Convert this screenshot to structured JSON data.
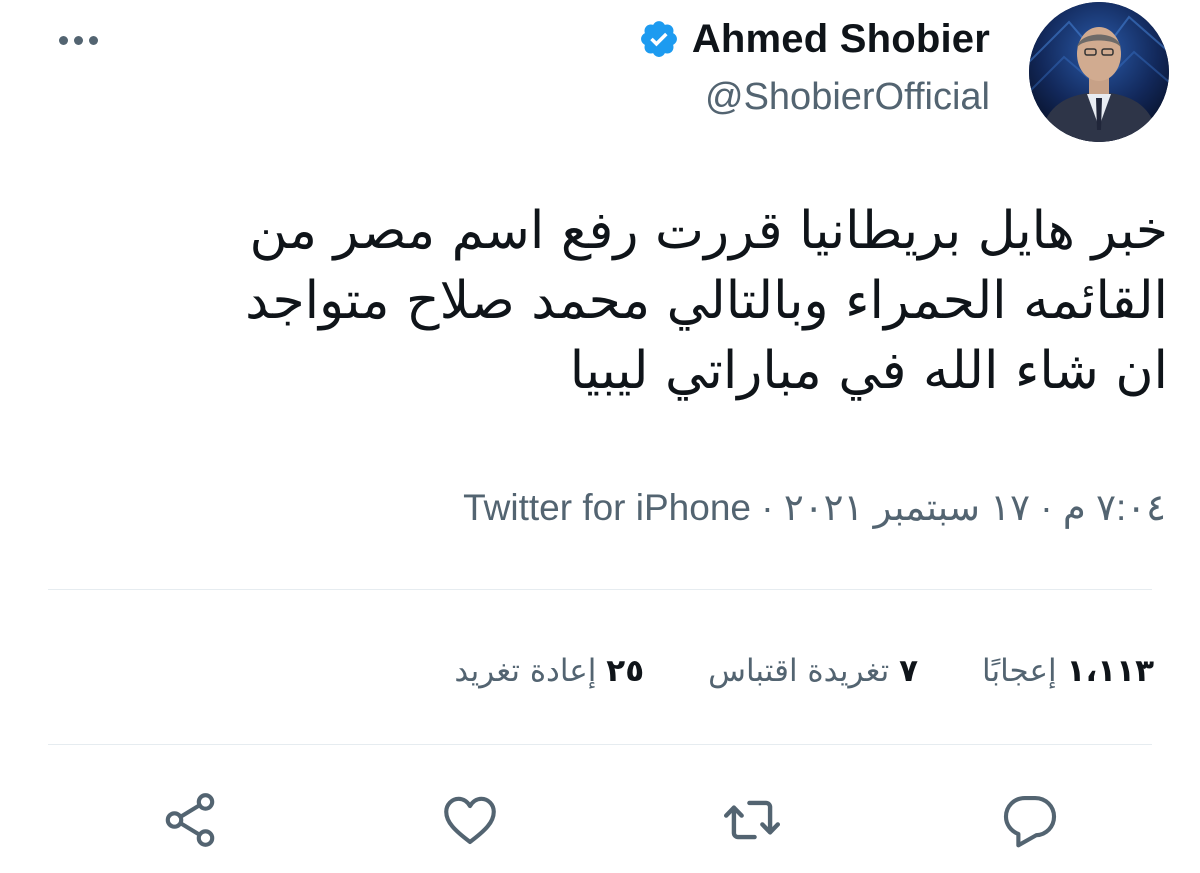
{
  "header": {
    "display_name": "Ahmed Shobier",
    "handle": "@ShobierOfficial",
    "more_icon": "more-horizontal-icon",
    "verified_icon": "verified-badge-icon",
    "verified_color": "#1d9bf0"
  },
  "tweet": {
    "text_lines": [
      "خبر هايل بريطانيا قررت رفع اسم مصر من",
      "القائمه الحمراء وبالتالي محمد صلاح متواجد",
      "ان شاء الله في مباراتي ليبيا"
    ]
  },
  "meta": {
    "time": "٧:٠٤ م",
    "separator": "·",
    "date": "١٧ سبتمبر ٢٠٢١",
    "source": "Twitter for iPhone"
  },
  "stats": {
    "retweets": {
      "count": "٢٥",
      "label": "إعادة تغريد"
    },
    "quotes": {
      "count": "٧",
      "label": "تغريدة اقتباس"
    },
    "likes": {
      "count": "١،١١٣",
      "label": "إعجابًا"
    }
  },
  "actions": {
    "reply_icon": "reply-icon",
    "retweet_icon": "retweet-icon",
    "like_icon": "heart-icon",
    "share_icon": "share-icon"
  },
  "colors": {
    "text_primary": "#0f1419",
    "text_secondary": "#536471",
    "divider": "#e6ecf0",
    "icon": "#536471"
  }
}
